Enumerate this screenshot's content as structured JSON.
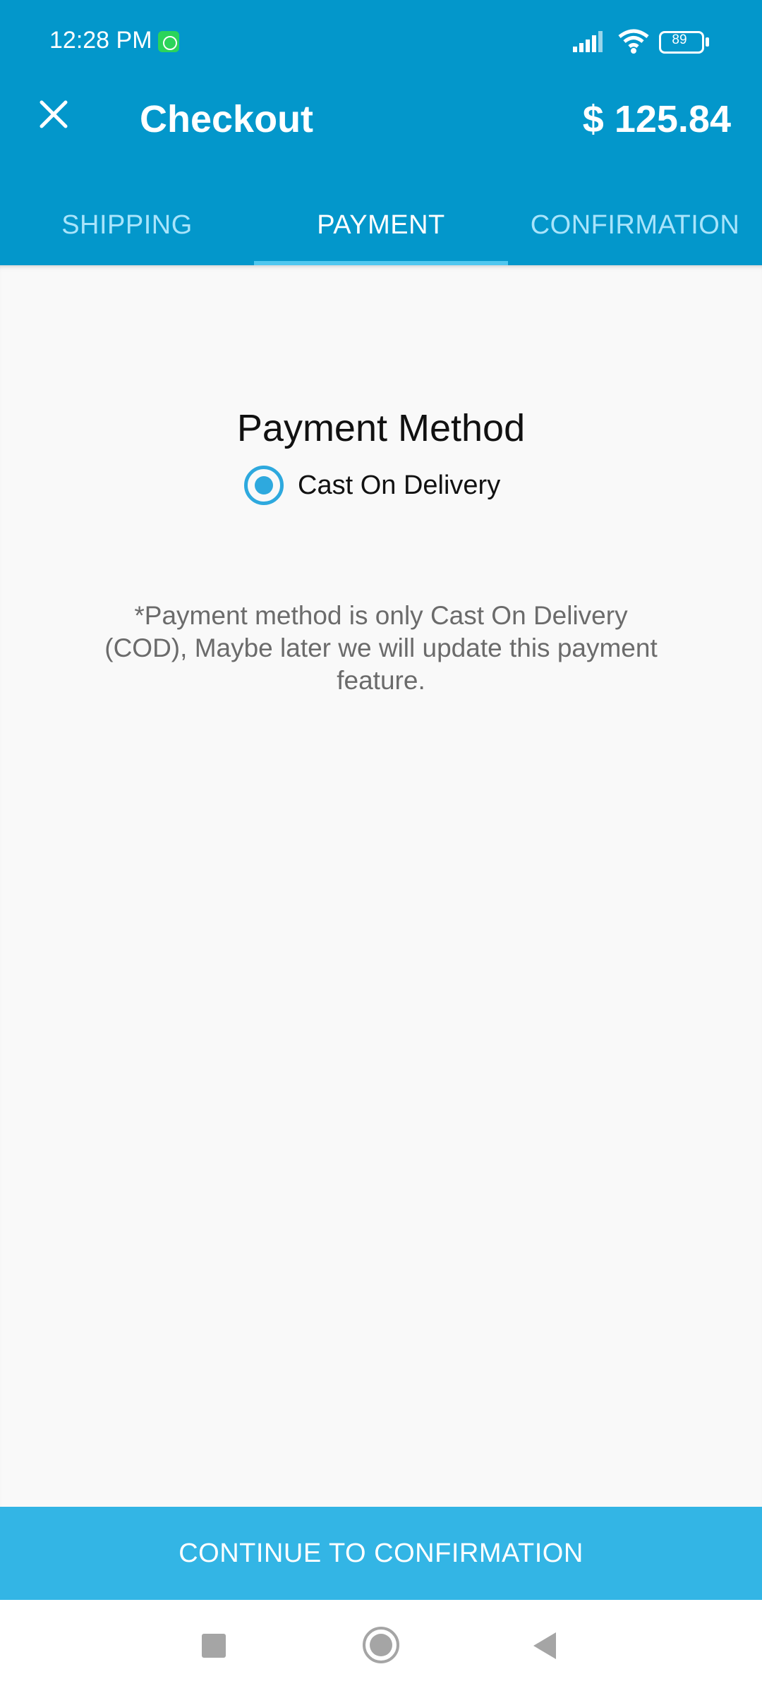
{
  "status_bar": {
    "time": "12:28 PM",
    "battery_level": "89",
    "icons": [
      "whatsapp-icon",
      "signal-icon",
      "wifi-icon",
      "battery-icon"
    ]
  },
  "header": {
    "title": "Checkout",
    "total": "$ 125.84",
    "close_icon": "close-icon"
  },
  "tabs": [
    {
      "label": "SHIPPING",
      "active": false
    },
    {
      "label": "PAYMENT",
      "active": true
    },
    {
      "label": "CONFIRMATION",
      "active": false
    }
  ],
  "payment": {
    "section_title": "Payment Method",
    "option_label": "Cast On Delivery",
    "option_selected": true,
    "note": "*Payment method is only Cast On Delivery (COD), Maybe later we will update this payment feature."
  },
  "footer": {
    "continue_label": "CONTINUE TO CONFIRMATION"
  },
  "nav_bar": {
    "icons": [
      "recent-apps-icon",
      "home-icon",
      "back-icon"
    ]
  },
  "colors": {
    "app_bar": "#0397cb",
    "accent": "#33b5e5",
    "radio": "#2ea9de",
    "tab_inactive": "#a8e4fb"
  }
}
